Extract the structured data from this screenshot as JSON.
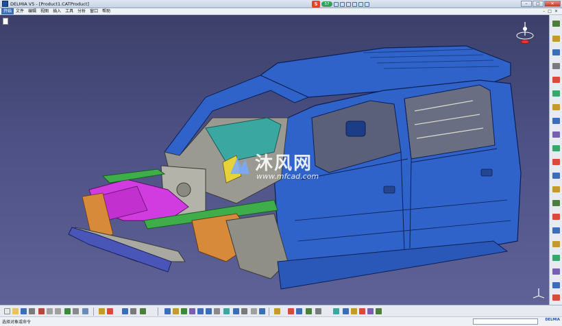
{
  "window": {
    "title": "DELMIA V5 - [Product1.CATProduct]",
    "minimize": "–",
    "maximize": "□",
    "close": "✕"
  },
  "ime": {
    "logo": "S",
    "badge": "57"
  },
  "menu": {
    "items": [
      "开始",
      "文件",
      "编辑",
      "视图",
      "插入",
      "工具",
      "分析",
      "窗口",
      "帮助"
    ],
    "active_index": 0,
    "controls": [
      "–",
      "□",
      "✕"
    ]
  },
  "watermark": {
    "title": "沐风网",
    "url": "www.mfcad.com"
  },
  "statusbar": {
    "prompt": "选择对象或命令",
    "brand": "DELMIA"
  },
  "colors": {
    "body_blue": "#2f63c9",
    "magenta": "#d13ce0",
    "orange": "#d68a3a",
    "green": "#3fae4a",
    "teal": "#3aa7a0",
    "yellow": "#e8d23a",
    "gray": "#9a9a92",
    "background": "#4d5185"
  }
}
